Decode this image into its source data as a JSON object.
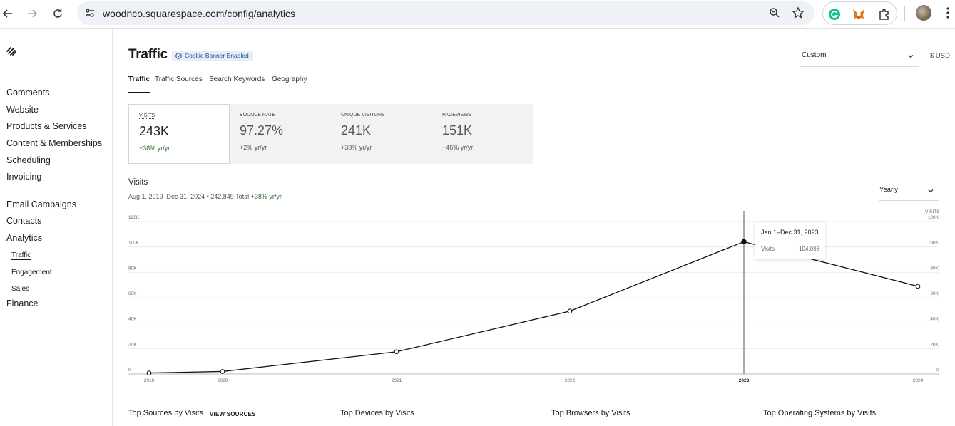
{
  "browser": {
    "url": "woodnco.squarespace.com/config/analytics"
  },
  "sidebar": {
    "items": [
      {
        "label": "Comments"
      },
      {
        "label": "Website"
      },
      {
        "label": "Products & Services"
      },
      {
        "label": "Content & Memberships"
      },
      {
        "label": "Scheduling"
      },
      {
        "label": "Invoicing"
      },
      {
        "label": "Email Campaigns"
      },
      {
        "label": "Contacts"
      },
      {
        "label": "Analytics"
      }
    ],
    "analytics_sub": [
      {
        "label": "Traffic",
        "active": true
      },
      {
        "label": "Engagement"
      },
      {
        "label": "Sales"
      }
    ],
    "finance": "Finance"
  },
  "header": {
    "title": "Traffic",
    "badge": "Cookie Banner Enabled",
    "range": "Custom",
    "currency": "$ USD"
  },
  "tabs": [
    {
      "label": "Traffic",
      "active": true
    },
    {
      "label": "Traffic Sources"
    },
    {
      "label": "Search Keywords"
    },
    {
      "label": "Geography"
    }
  ],
  "stats": [
    {
      "label": "VISITS",
      "value": "243K",
      "change": "+38% yr/yr",
      "active": true
    },
    {
      "label": "BOUNCE RATE",
      "value": "97.27%",
      "change": "+2% yr/yr"
    },
    {
      "label": "UNIQUE VISITORS",
      "value": "241K",
      "change": "+38% yr/yr"
    },
    {
      "label": "PAGEVIEWS",
      "value": "151K",
      "change": "+46% yr/yr"
    }
  ],
  "chart_section": {
    "title": "Visits",
    "subtitle": "Aug 1, 2019–Dec 31, 2024 • 242,849 Total",
    "subtitle_change": "+38% yr/yr",
    "period": "Yearly",
    "right_axis_label": "VISITS"
  },
  "tooltip": {
    "range": "Jan 1–Dec 31, 2023",
    "label": "Visits",
    "value": "104,088"
  },
  "bottom": {
    "headings": [
      "Top Sources by Visits",
      "Top Devices by Visits",
      "Top Browsers by Visits",
      "Top Operating Systems by Visits"
    ],
    "view_sources": "VIEW SOURCES"
  },
  "chart_data": {
    "type": "line",
    "x": [
      "2019",
      "2020",
      "2021",
      "2022",
      "2023",
      "2024"
    ],
    "values": [
      800,
      2000,
      17500,
      49500,
      104088,
      69000
    ],
    "ylim": [
      0,
      120000
    ],
    "yticks": [
      "0",
      "20K",
      "40K",
      "60K",
      "80K",
      "100K",
      "120K"
    ],
    "grid": true,
    "highlight_index": 4,
    "line_color": "#111111"
  }
}
